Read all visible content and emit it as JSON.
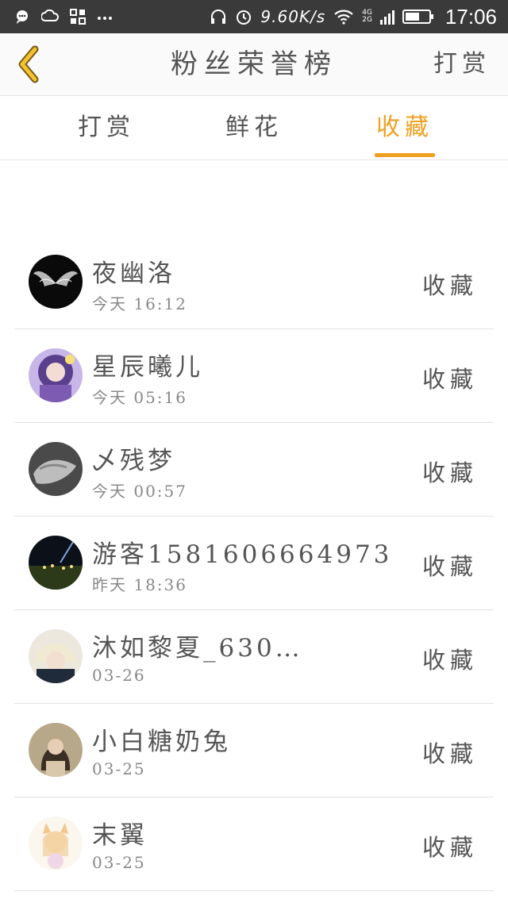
{
  "status_bar": {
    "speed": "9.60K/s",
    "net_top": "4G",
    "net_bottom": "2G",
    "time": "17:06"
  },
  "nav": {
    "title": "粉丝荣誉榜",
    "action": "打赏"
  },
  "tabs": [
    {
      "label": "打赏",
      "active": false
    },
    {
      "label": "鲜花",
      "active": false
    },
    {
      "label": "收藏",
      "active": true
    }
  ],
  "colors": {
    "accent": "#f0a020",
    "status_bar_bg": "#3a3a3a",
    "text": "#555555"
  },
  "fans": [
    {
      "name": "夜幽洛",
      "time": "今天 16:12",
      "action": "收藏",
      "avatar": "wings-avatar"
    },
    {
      "name": "星辰曦儿",
      "time": "今天 05:16",
      "action": "收藏",
      "avatar": "anime-girl-purple-avatar"
    },
    {
      "name": "乄残梦",
      "time": "今天 00:57",
      "action": "收藏",
      "avatar": "hand-gray-avatar"
    },
    {
      "name": "游客1581606664973",
      "time": "昨天 18:36",
      "action": "收藏",
      "avatar": "night-city-avatar"
    },
    {
      "name": "沐如黎夏_630…",
      "time": "03-26",
      "action": "收藏",
      "avatar": "anime-boy-avatar"
    },
    {
      "name": "小白糖奶兔",
      "time": "03-25",
      "action": "收藏",
      "avatar": "girl-photo-avatar"
    },
    {
      "name": "末翼",
      "time": "03-25",
      "action": "收藏",
      "avatar": "fox-girl-avatar"
    }
  ]
}
